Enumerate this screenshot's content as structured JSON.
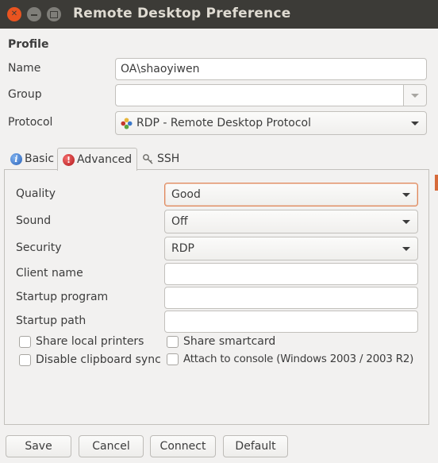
{
  "window": {
    "title": "Remote Desktop Preference"
  },
  "profile": {
    "heading": "Profile",
    "name_label": "Name",
    "name_value": "OA\\shaoyiwen",
    "group_label": "Group",
    "group_value": "",
    "protocol_label": "Protocol",
    "protocol_value": "RDP - Remote Desktop Protocol"
  },
  "tabs": [
    {
      "label": "Basic",
      "icon": "info-icon",
      "active": false
    },
    {
      "label": "Advanced",
      "icon": "warning-icon",
      "active": true
    },
    {
      "label": "SSH",
      "icon": "key-icon",
      "active": false
    }
  ],
  "advanced": {
    "quality_label": "Quality",
    "quality_value": "Good",
    "sound_label": "Sound",
    "sound_value": "Off",
    "security_label": "Security",
    "security_value": "RDP",
    "client_name_label": "Client name",
    "client_name_value": "",
    "startup_program_label": "Startup program",
    "startup_program_value": "",
    "startup_path_label": "Startup path",
    "startup_path_value": "",
    "share_printers_label": "Share local printers",
    "share_smartcard_label": "Share smartcard",
    "disable_clipboard_label": "Disable clipboard sync",
    "attach_console_label": "Attach to console (Windows 2003 / 2003 R2)"
  },
  "buttons": {
    "save": "Save",
    "cancel": "Cancel",
    "connect": "Connect",
    "default": "Default"
  },
  "colors": {
    "titlebar": "#3c3b37",
    "close_button": "#e95420",
    "focus_accent": "#e0875a",
    "window_bg": "#f2f1f0"
  }
}
